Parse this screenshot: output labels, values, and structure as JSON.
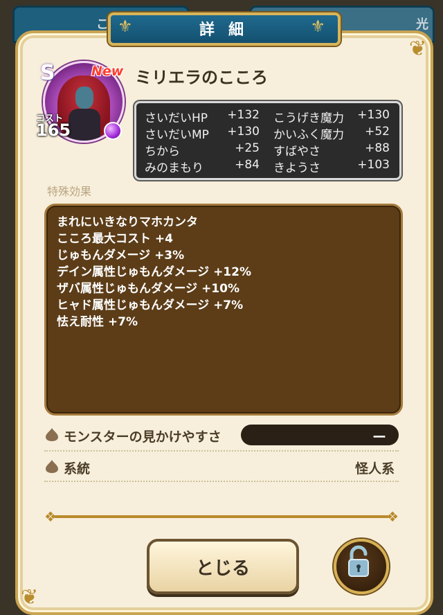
{
  "background_tabs": {
    "left_label": "こ",
    "right_label": "光"
  },
  "dialog": {
    "title": "詳細"
  },
  "character": {
    "rank": "S",
    "new_badge": "New",
    "name": "ミリエラのこころ",
    "cost_label": "コスト",
    "cost_value": "165"
  },
  "stats": [
    {
      "name": "さいだいHP",
      "value": "+132"
    },
    {
      "name": "こうげき魔力",
      "value": "+130"
    },
    {
      "name": "さいだいMP",
      "value": "+130"
    },
    {
      "name": "かいふく魔力",
      "value": "+52"
    },
    {
      "name": "ちから",
      "value": "+25"
    },
    {
      "name": "すばやさ",
      "value": "+88"
    },
    {
      "name": "みのまもり",
      "value": "+84"
    },
    {
      "name": "きようさ",
      "value": "+103"
    }
  ],
  "special_effects": {
    "label": "特殊効果",
    "items": [
      "まれにいきなりマホカンタ",
      "こころ最大コスト +4",
      "じゅもんダメージ +3%",
      "デイン属性じゅもんダメージ +12%",
      "ザバ属性じゅもんダメージ +10%",
      "ヒャド属性じゅもんダメージ +7%",
      "怯え耐性 +7%"
    ]
  },
  "info": {
    "visibility_label": "モンスターの見かけやすさ",
    "visibility_value": "ー",
    "family_label": "系統",
    "family_value": "怪人系"
  },
  "buttons": {
    "close_label": "とじる"
  },
  "colors": {
    "accent_gold": "#c9a451",
    "title_blue": "#1f6a8e",
    "panel_bg": "#f7efdb",
    "effects_bg": "#5c3d18"
  },
  "icons": {
    "row_icon": "slime-drop-icon",
    "lock": "unlocked-padlock-icon"
  }
}
